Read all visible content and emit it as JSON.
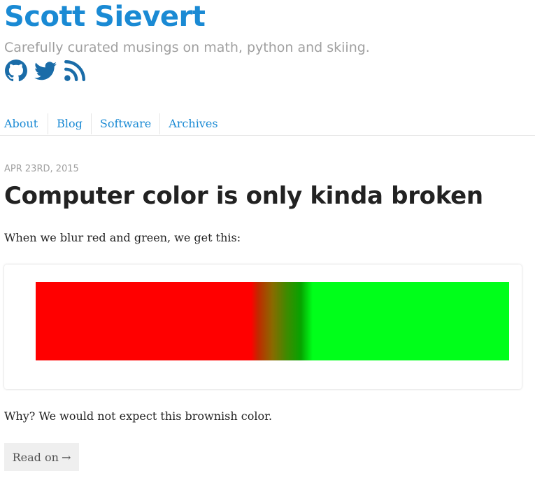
{
  "site": {
    "title": "Scott Sievert",
    "tagline": "Carefully curated musings on math, python and skiing."
  },
  "social": [
    {
      "name": "github-icon"
    },
    {
      "name": "twitter-icon"
    },
    {
      "name": "rss-icon"
    }
  ],
  "colors": {
    "accent": "#1a8ad4",
    "muted": "#a0a0a0",
    "red": "#ff0000",
    "green": "#00ff1a"
  },
  "nav": {
    "items": [
      "About",
      "Blog",
      "Software",
      "Archives"
    ]
  },
  "post": {
    "date": "APR 23RD, 2015",
    "title": "Computer color is only kinda broken",
    "intro": "When we blur red and green, we get this:",
    "question": "Why? We would not expect this brownish color.",
    "read_on": "Read on",
    "read_on_arrow": "→"
  }
}
